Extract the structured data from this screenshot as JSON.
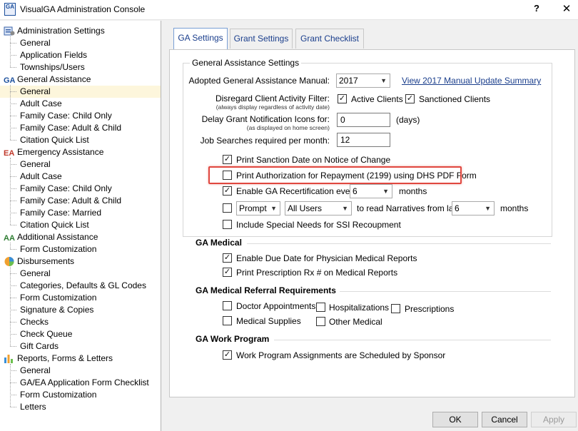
{
  "window": {
    "title": "VisualGA Administration Console",
    "help": "?",
    "close": "✕",
    "icon_text": "GA"
  },
  "tree": [
    {
      "type": "cat",
      "label": "Administration Settings",
      "icon": "admin-settings-icon"
    },
    {
      "type": "item",
      "label": "General"
    },
    {
      "type": "item",
      "label": "Application Fields"
    },
    {
      "type": "item",
      "label": "Townships/Users"
    },
    {
      "type": "cat",
      "label": "General Assistance",
      "icon": "ga-icon"
    },
    {
      "type": "item",
      "label": "General",
      "selected": true
    },
    {
      "type": "item",
      "label": "Adult Case"
    },
    {
      "type": "item",
      "label": "Family Case: Child Only"
    },
    {
      "type": "item",
      "label": "Family Case: Adult & Child"
    },
    {
      "type": "item",
      "label": "Citation Quick List"
    },
    {
      "type": "cat",
      "label": "Emergency Assistance",
      "icon": "ea-icon"
    },
    {
      "type": "item",
      "label": "General"
    },
    {
      "type": "item",
      "label": "Adult Case"
    },
    {
      "type": "item",
      "label": "Family Case: Child Only"
    },
    {
      "type": "item",
      "label": "Family Case: Adult & Child"
    },
    {
      "type": "item",
      "label": "Family Case: Married"
    },
    {
      "type": "item",
      "label": "Citation Quick List"
    },
    {
      "type": "cat",
      "label": "Additional Assistance",
      "icon": "aa-icon"
    },
    {
      "type": "item",
      "label": "Form Customization"
    },
    {
      "type": "cat",
      "label": "Disbursements",
      "icon": "disbursements-icon"
    },
    {
      "type": "item",
      "label": "General"
    },
    {
      "type": "item",
      "label": "Categories, Defaults & GL Codes"
    },
    {
      "type": "item",
      "label": "Form Customization"
    },
    {
      "type": "item",
      "label": "Signature & Copies"
    },
    {
      "type": "item",
      "label": "Checks"
    },
    {
      "type": "item",
      "label": "Check Queue"
    },
    {
      "type": "item",
      "label": "Gift Cards"
    },
    {
      "type": "cat",
      "label": "Reports, Forms & Letters",
      "icon": "reports-icon"
    },
    {
      "type": "item",
      "label": "General"
    },
    {
      "type": "item",
      "label": "GA/EA Application Form Checklist"
    },
    {
      "type": "item",
      "label": "Form Customization"
    },
    {
      "type": "item",
      "label": "Letters"
    }
  ],
  "tabs": [
    {
      "label": "GA Settings",
      "active": true
    },
    {
      "label": "Grant Settings",
      "active": false
    },
    {
      "label": "Grant Checklist",
      "active": false
    }
  ],
  "settings": {
    "group_title": "General Assistance Settings",
    "manual_label": "Adopted General Assistance Manual:",
    "manual_value": "2017",
    "manual_link": "View 2017 Manual Update Summary",
    "disregard_label": "Disregard Client Activity Filter:",
    "disregard_sub": "(always display regardless of activity date)",
    "active_clients": {
      "label": "Active Clients",
      "checked": true
    },
    "sanctioned_clients": {
      "label": "Sanctioned Clients",
      "checked": true
    },
    "delay_label": "Delay Grant Notification Icons for:",
    "delay_sub": "(as displayed on home screen)",
    "delay_value": "0",
    "delay_unit": "(days)",
    "job_label": "Job Searches required per month:",
    "job_value": "12",
    "print_sanction": {
      "label": "Print Sanction Date on Notice of Change",
      "checked": true
    },
    "print_authorization": {
      "label": "Print Authorization for Repayment (2199) using DHS PDF Form",
      "checked": false
    },
    "enable_recert": {
      "label": "Enable GA Recertification every",
      "checked": true
    },
    "recert_value": "6",
    "recert_unit": "months",
    "narratives": {
      "checked": false,
      "mode": "Prompt",
      "users": "All Users",
      "label": "to read Narratives from last",
      "value": "6",
      "unit": "months"
    },
    "special_needs": {
      "label": "Include Special Needs for SSI Recoupment",
      "checked": false
    }
  },
  "ga_medical": {
    "title": "GA Medical",
    "due_date": {
      "label": "Enable Due Date for Physician Medical Reports",
      "checked": true
    },
    "prescription": {
      "label": "Print Prescription Rx # on Medical Reports",
      "checked": true
    }
  },
  "referral": {
    "title": "GA Medical Referral Requirements",
    "doctor": {
      "label": "Doctor Appointments",
      "checked": false
    },
    "hospitalizations": {
      "label": "Hospitalizations",
      "checked": false
    },
    "prescriptions": {
      "label": "Prescriptions",
      "checked": false
    },
    "supplies": {
      "label": "Medical Supplies",
      "checked": false
    },
    "other": {
      "label": "Other Medical",
      "checked": false
    }
  },
  "work": {
    "title": "GA Work Program",
    "assignments": {
      "label": "Work Program Assignments are Scheduled by Sponsor",
      "checked": true
    }
  },
  "buttons": {
    "ok": "OK",
    "cancel": "Cancel",
    "apply": "Apply"
  },
  "colors": {
    "highlight": "#e0473f",
    "link": "#1a3e8c",
    "selected_row": "#fdf6dc"
  }
}
